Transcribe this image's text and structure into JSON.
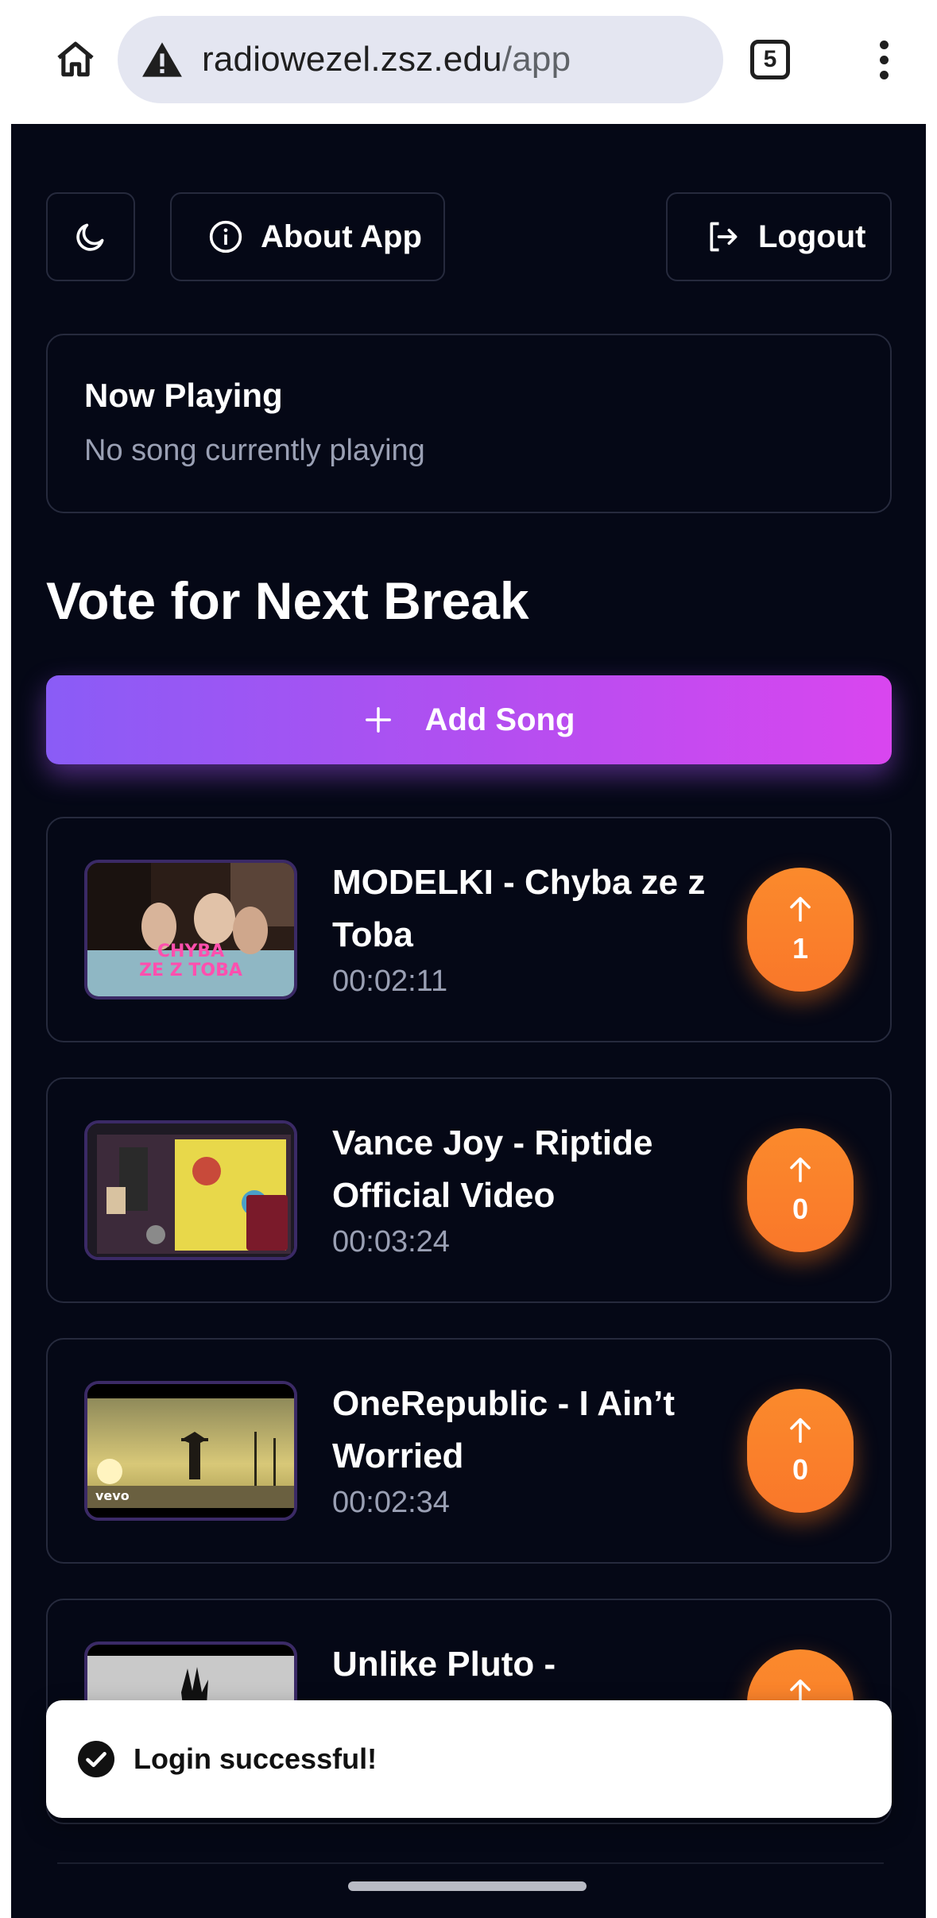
{
  "browser": {
    "url_host": "radiowezel.zsz.edu",
    "url_path": "/app",
    "tab_count": "5"
  },
  "toolbar": {
    "about_label": "About App",
    "logout_label": "Logout"
  },
  "now_playing": {
    "title": "Now Playing",
    "status": "No song currently playing"
  },
  "vote_section": {
    "title": "Vote for Next Break",
    "add_song_label": "Add Song"
  },
  "songs": [
    {
      "title": "MODELKI - Chyba ze z Toba",
      "duration": "00:02:11",
      "votes": "1"
    },
    {
      "title": "Vance Joy - Riptide Official Video",
      "duration": "00:03:24",
      "votes": "0"
    },
    {
      "title": "OneRepublic - I Ain’t Worried",
      "duration": "00:02:34",
      "votes": "0"
    },
    {
      "title": "Unlike Pluto -",
      "duration": "",
      "votes": ""
    }
  ],
  "thumbnails": {
    "modelki_text": "CHYBA ZE Z TOBA",
    "vevo_label": "vevo"
  },
  "toast": {
    "message": "Login successful!"
  },
  "colors": {
    "background": "#050816",
    "accent_gradient_start": "#8a5cf6",
    "accent_gradient_end": "#d946ef",
    "vote_orange": "#f9772a"
  }
}
